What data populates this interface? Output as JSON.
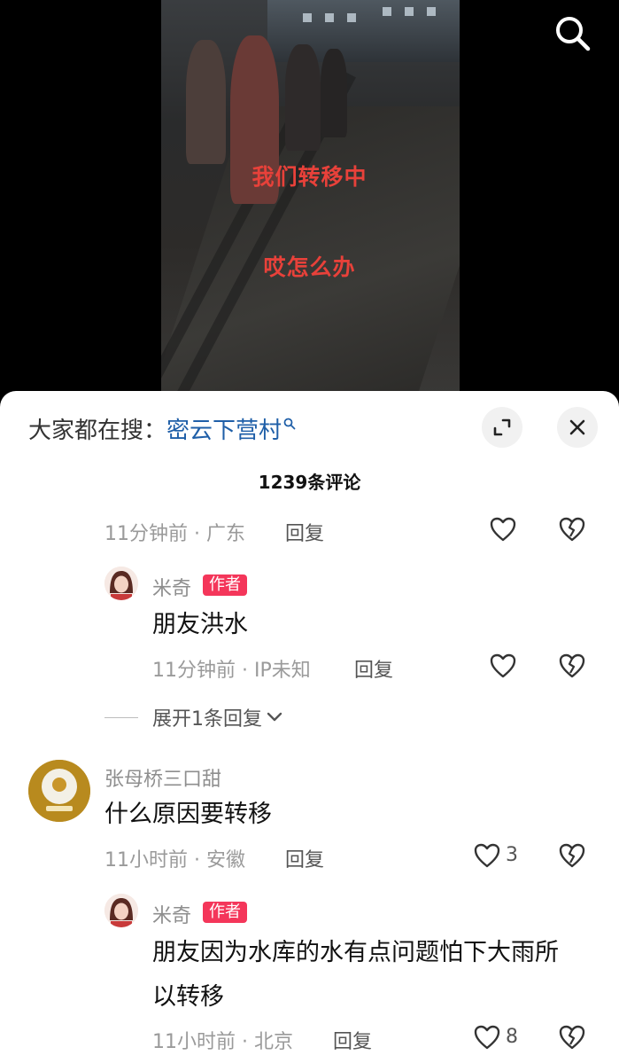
{
  "video": {
    "caption1": "我们转移中",
    "caption2": "哎怎么办",
    "search_icon": "search-icon"
  },
  "sheet": {
    "trend_prefix": "大家都在搜：",
    "trend_link": "密云下营村",
    "comment_count": "1239条评论"
  },
  "comments": [
    {
      "meta": "11分钟前 · 广东",
      "reply": "回复"
    },
    {
      "username": "米奇",
      "badge": "作者",
      "text": "朋友洪水",
      "meta": "11分钟前 · IP未知",
      "reply": "回复"
    },
    {
      "expand": "展开1条回复"
    },
    {
      "username": "张母桥三口甜",
      "text": "什么原因要转移",
      "meta": "11小时前 · 安徽",
      "reply": "回复",
      "likes": "3"
    },
    {
      "username": "米奇",
      "badge": "作者",
      "text_line1": "朋友因为水库的水有点问题怕下大雨所",
      "text_line2": "以转移",
      "meta": "11小时前 · 北京",
      "reply": "回复",
      "likes": "8"
    }
  ],
  "colors": {
    "badge": "#f4365a",
    "link": "#1f5fa8",
    "caption": "#e8413a"
  }
}
